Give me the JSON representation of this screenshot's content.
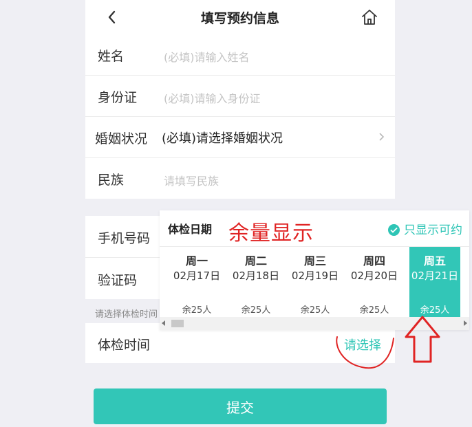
{
  "header": {
    "title": "填写预约信息",
    "back_icon": "chevron-left-icon",
    "home_icon": "home-icon"
  },
  "form": {
    "name": {
      "label": "姓名",
      "placeholder": "(必填)请输入姓名"
    },
    "id_card": {
      "label": "身份证",
      "placeholder": "(必填)请输入身份证"
    },
    "marital": {
      "label": "婚姻状况",
      "value": "(必填)请选择婚姻状况"
    },
    "ethnicity": {
      "label": "民族",
      "placeholder": "请填写民族"
    },
    "phone": {
      "label": "手机号码"
    },
    "code": {
      "label": "验证码"
    },
    "exam_hint": "请选择体检时间",
    "exam_time": {
      "label": "体检时间",
      "action": "请选择"
    },
    "submit_label": "提交"
  },
  "date_picker": {
    "title": "体检日期",
    "annotation": "余量显示",
    "filter_label": "只显示可约",
    "days": [
      {
        "weekday": "周一",
        "date": "02月17日",
        "remaining": "余25人"
      },
      {
        "weekday": "周二",
        "date": "02月18日",
        "remaining": "余25人"
      },
      {
        "weekday": "周三",
        "date": "02月19日",
        "remaining": "余25人"
      },
      {
        "weekday": "周四",
        "date": "02月20日",
        "remaining": "余25人"
      },
      {
        "weekday": "周五",
        "date": "02月21日",
        "remaining": "余25人"
      }
    ],
    "selected_index": 4
  },
  "colors": {
    "accent": "#32c6b7",
    "annotation": "#e02424",
    "background": "#efeff4"
  }
}
